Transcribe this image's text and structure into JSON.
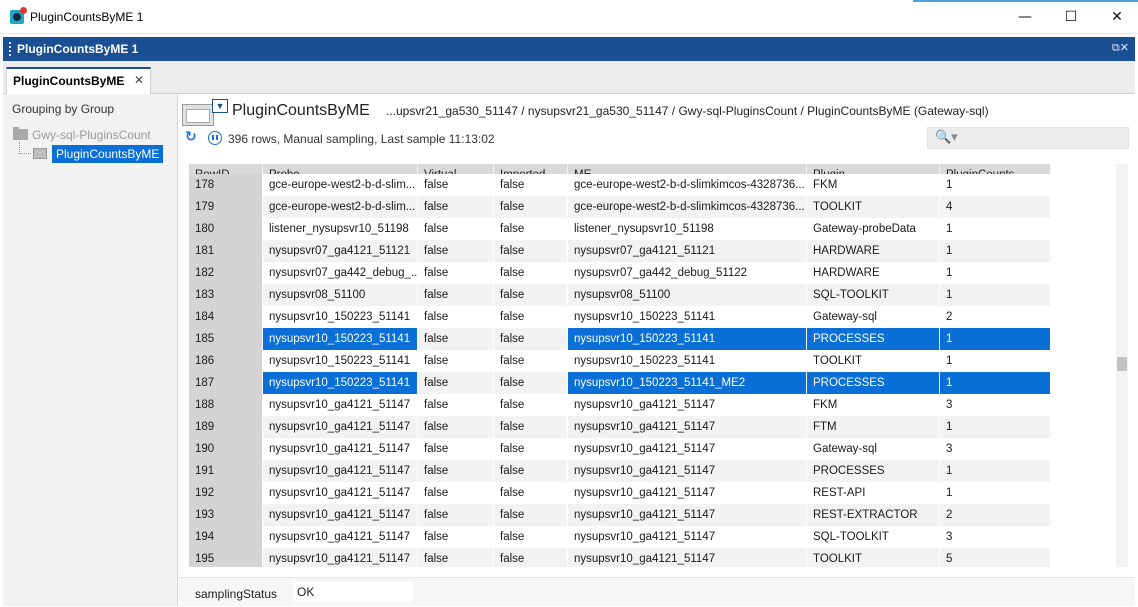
{
  "window": {
    "title": "PluginCountsByME 1",
    "minimize": "—",
    "maximize": "☐",
    "close": "✕"
  },
  "panel": {
    "title": "PluginCountsByME 1",
    "icons": "⧉✕"
  },
  "tab": {
    "label": "PluginCountsByME",
    "close": "✕"
  },
  "sidebar": {
    "grouping_title": "Grouping by Group",
    "root_label": "Gwy-sql-PluginsCount",
    "child_label": "PluginCountsByME"
  },
  "view": {
    "title": "PluginCountsByME",
    "path": "...upsvr21_ga530_51147 / nysupsvr21_ga530_51147 / Gwy-sql-PluginsCount / PluginCountsByME (Gateway-sql)",
    "status": "396 rows, Manual sampling, Last sample 11:13:02",
    "refresh_icon": "↻",
    "search_icon": "🔍▾",
    "search_value": ""
  },
  "grid": {
    "columns": [
      "RowID",
      "Probe",
      "Virtual",
      "Imported",
      "ME",
      "Plugin",
      "PluginCounts"
    ],
    "rows": [
      {
        "id": "178",
        "probe": "gce-europe-west2-b-d-slim...",
        "virtual": "false",
        "imported": "false",
        "me": "gce-europe-west2-b-d-slimkimcos-4328736...",
        "plugin": "FKM",
        "count": "1",
        "selected": false
      },
      {
        "id": "179",
        "probe": "gce-europe-west2-b-d-slim...",
        "virtual": "false",
        "imported": "false",
        "me": "gce-europe-west2-b-d-slimkimcos-4328736...",
        "plugin": "TOOLKIT",
        "count": "4",
        "selected": false
      },
      {
        "id": "180",
        "probe": "listener_nysupsvr10_51198",
        "virtual": "false",
        "imported": "false",
        "me": "listener_nysupsvr10_51198",
        "plugin": "Gateway-probeData",
        "count": "1",
        "selected": false
      },
      {
        "id": "181",
        "probe": "nysupsvr07_ga4121_51121",
        "virtual": "false",
        "imported": "false",
        "me": "nysupsvr07_ga4121_51121",
        "plugin": "HARDWARE",
        "count": "1",
        "selected": false
      },
      {
        "id": "182",
        "probe": "nysupsvr07_ga442_debug_...",
        "virtual": "false",
        "imported": "false",
        "me": "nysupsvr07_ga442_debug_51122",
        "plugin": "HARDWARE",
        "count": "1",
        "selected": false
      },
      {
        "id": "183",
        "probe": "nysupsvr08_51100",
        "virtual": "false",
        "imported": "false",
        "me": "nysupsvr08_51100",
        "plugin": "SQL-TOOLKIT",
        "count": "1",
        "selected": false
      },
      {
        "id": "184",
        "probe": "nysupsvr10_150223_51141",
        "virtual": "false",
        "imported": "false",
        "me": "nysupsvr10_150223_51141",
        "plugin": "Gateway-sql",
        "count": "2",
        "selected": false
      },
      {
        "id": "185",
        "probe": "nysupsvr10_150223_51141",
        "virtual": "false",
        "imported": "false",
        "me": "nysupsvr10_150223_51141",
        "plugin": "PROCESSES",
        "count": "1",
        "selected": true
      },
      {
        "id": "186",
        "probe": "nysupsvr10_150223_51141",
        "virtual": "false",
        "imported": "false",
        "me": "nysupsvr10_150223_51141",
        "plugin": "TOOLKIT",
        "count": "1",
        "selected": false
      },
      {
        "id": "187",
        "probe": "nysupsvr10_150223_51141",
        "virtual": "false",
        "imported": "false",
        "me": "nysupsvr10_150223_51141_ME2",
        "plugin": "PROCESSES",
        "count": "1",
        "selected": true
      },
      {
        "id": "188",
        "probe": "nysupsvr10_ga4121_51147",
        "virtual": "false",
        "imported": "false",
        "me": "nysupsvr10_ga4121_51147",
        "plugin": "FKM",
        "count": "3",
        "selected": false
      },
      {
        "id": "189",
        "probe": "nysupsvr10_ga4121_51147",
        "virtual": "false",
        "imported": "false",
        "me": "nysupsvr10_ga4121_51147",
        "plugin": "FTM",
        "count": "1",
        "selected": false
      },
      {
        "id": "190",
        "probe": "nysupsvr10_ga4121_51147",
        "virtual": "false",
        "imported": "false",
        "me": "nysupsvr10_ga4121_51147",
        "plugin": "Gateway-sql",
        "count": "3",
        "selected": false
      },
      {
        "id": "191",
        "probe": "nysupsvr10_ga4121_51147",
        "virtual": "false",
        "imported": "false",
        "me": "nysupsvr10_ga4121_51147",
        "plugin": "PROCESSES",
        "count": "1",
        "selected": false
      },
      {
        "id": "192",
        "probe": "nysupsvr10_ga4121_51147",
        "virtual": "false",
        "imported": "false",
        "me": "nysupsvr10_ga4121_51147",
        "plugin": "REST-API",
        "count": "1",
        "selected": false
      },
      {
        "id": "193",
        "probe": "nysupsvr10_ga4121_51147",
        "virtual": "false",
        "imported": "false",
        "me": "nysupsvr10_ga4121_51147",
        "plugin": "REST-EXTRACTOR",
        "count": "2",
        "selected": false
      },
      {
        "id": "194",
        "probe": "nysupsvr10_ga4121_51147",
        "virtual": "false",
        "imported": "false",
        "me": "nysupsvr10_ga4121_51147",
        "plugin": "SQL-TOOLKIT",
        "count": "3",
        "selected": false
      },
      {
        "id": "195",
        "probe": "nysupsvr10_ga4121_51147",
        "virtual": "false",
        "imported": "false",
        "me": "nysupsvr10_ga4121_51147",
        "plugin": "TOOLKIT",
        "count": "5",
        "selected": false
      }
    ]
  },
  "footer": {
    "label": "samplingStatus",
    "value": "OK"
  },
  "colors": {
    "accent": "#1b4f93",
    "selection": "#0a6fd6"
  }
}
